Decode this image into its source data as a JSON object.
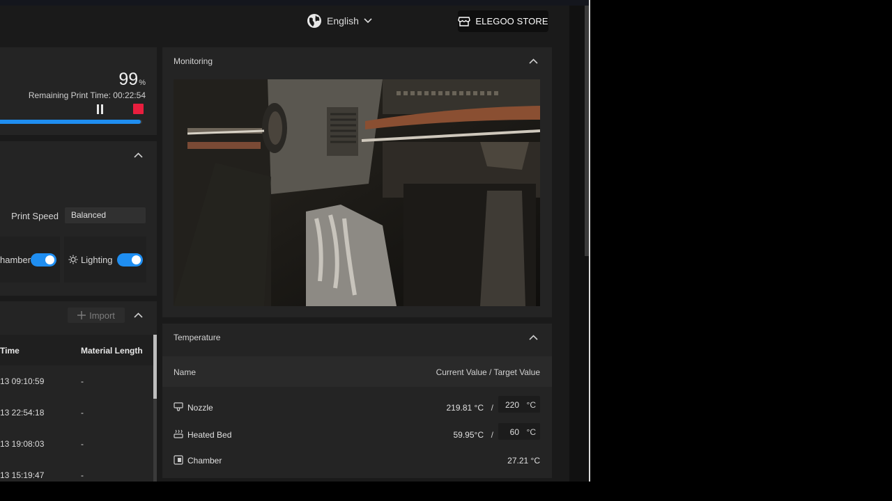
{
  "header": {
    "language": "English",
    "store_label": "ELEGOO STORE"
  },
  "progress": {
    "percent": "99",
    "percent_unit": "%",
    "remaining_label": "Remaining Print Time:",
    "remaining_value": "00:22:54",
    "fraction": 0.99
  },
  "controls": {
    "speed_label": "Print Speed",
    "speed_value": "Balanced",
    "chamber_label": "hamber",
    "chamber_on": true,
    "lighting_label": "Lighting",
    "lighting_on": true
  },
  "files": {
    "import_label": "Import",
    "columns": [
      "Time",
      "Material Length"
    ],
    "rows": [
      {
        "time": "13 09:10:59",
        "length": "-"
      },
      {
        "time": "13 22:54:18",
        "length": "-"
      },
      {
        "time": "13 19:08:03",
        "length": "-"
      },
      {
        "time": "13 15:19:47",
        "length": "-"
      }
    ]
  },
  "monitoring": {
    "title": "Monitoring"
  },
  "temperature": {
    "title": "Temperature",
    "col_name": "Name",
    "col_value": "Current Value / Target Value",
    "rows": [
      {
        "name": "Nozzle",
        "current": "219.81 °C",
        "sep": "/",
        "target": "220",
        "unit": "°C",
        "icon": "nozzle-icon"
      },
      {
        "name": "Heated Bed",
        "current": "59.95°C",
        "sep": "/",
        "target": "60",
        "unit": "°C",
        "icon": "heated-bed-icon"
      },
      {
        "name": "Chamber",
        "current": "27.21 °C",
        "icon": "chamber-icon"
      }
    ]
  },
  "colors": {
    "accent": "#1f8ef1",
    "stop": "#e81e3e",
    "panel": "#242424",
    "background": "#1a1a1a"
  }
}
